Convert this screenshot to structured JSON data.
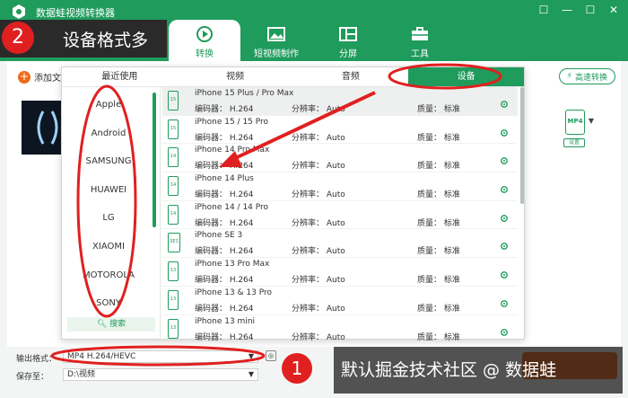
{
  "app": {
    "title": "数据蛙视频转换器"
  },
  "window_controls": [
    "☐",
    "—",
    "☐",
    "✕"
  ],
  "nav": {
    "tabs": [
      {
        "label": "转换"
      },
      {
        "label": "短视频制作"
      },
      {
        "label": "分屏"
      },
      {
        "label": "工具"
      }
    ]
  },
  "main": {
    "add_file": "添加文件",
    "fast_convert": "高速转换",
    "format_badge": "MP4",
    "settings": "设置"
  },
  "panel": {
    "tabs": [
      {
        "label": "最近使用"
      },
      {
        "label": "视频"
      },
      {
        "label": "音频"
      },
      {
        "label": "设备"
      }
    ],
    "brands": [
      "Apple",
      "Android",
      "SAMSUNG",
      "HUAWEI",
      "LG",
      "XIAOMI",
      "MOTOROLA",
      "SONY"
    ],
    "search": "搜索",
    "devices": [
      {
        "name": "iPhone 15 Plus / Pro Max",
        "icon": "15",
        "codec": "编码器：  H.264",
        "res": "分辨率：  Auto",
        "quality": "质量：  标准"
      },
      {
        "name": "iPhone 15 / 15 Pro",
        "icon": "15",
        "codec": "编码器：  H.264",
        "res": "分辨率：  Auto",
        "quality": "质量：  标准"
      },
      {
        "name": "iPhone 14 Pro Max",
        "icon": "14",
        "codec": "编码器：  H.264",
        "res": "分辨率：  Auto",
        "quality": "质量：  标准"
      },
      {
        "name": "iPhone 14 Plus",
        "icon": "14",
        "codec": "编码器：  H.264",
        "res": "分辨率：  Auto",
        "quality": "质量：  标准"
      },
      {
        "name": "iPhone 14 / 14 Pro",
        "icon": "14",
        "codec": "编码器：  H.264",
        "res": "分辨率：  Auto",
        "quality": "质量：  标准"
      },
      {
        "name": "iPhone SE 3",
        "icon": "SE3",
        "codec": "编码器：  H.264",
        "res": "分辨率：  Auto",
        "quality": "质量：  标准"
      },
      {
        "name": "iPhone 13 Pro Max",
        "icon": "13",
        "codec": "编码器：  H.264",
        "res": "分辨率：  Auto",
        "quality": "质量：  标准"
      },
      {
        "name": "iPhone 13 & 13 Pro",
        "icon": "13",
        "codec": "编码器：  H.264",
        "res": "分辨率：  Auto",
        "quality": "质量：  标准"
      },
      {
        "name": "iPhone 13 mini",
        "icon": "13",
        "codec": "编码器：  H.264",
        "res": "分辨率：  Auto",
        "quality": "质量：  标准"
      }
    ]
  },
  "bottom": {
    "output_label": "输出格式：",
    "output_value": "MP4 H.264/HEVC",
    "save_label": "保存至：",
    "save_value": "D:\\视频"
  },
  "annotations": {
    "callout_num": "2",
    "callout_text": "设备格式多",
    "num1": "1",
    "watermark": "默认掘金技术社区 @ 数据蛙"
  },
  "colors": {
    "brand_green": "#1f9b5c",
    "accent_orange": "#ef6a1a",
    "annotation_red": "#e02020"
  }
}
